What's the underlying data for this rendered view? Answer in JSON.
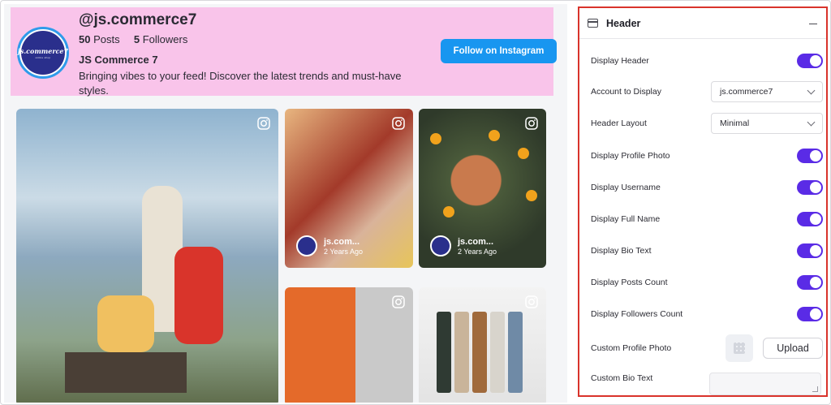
{
  "profile": {
    "username": "@js.commerce7",
    "posts_count": "50",
    "posts_label": "Posts",
    "followers_count": "5",
    "followers_label": "Followers",
    "full_name": "JS Commerce 7",
    "bio": "Bringing vibes to your feed! Discover the latest trends and must-have styles.",
    "avatar_brand": "js.commerce7",
    "avatar_tag": "online shop",
    "follow_label": "Follow on Instagram"
  },
  "feed": {
    "posts": [
      {
        "handle": "js.com...",
        "time": "2 Years Ago"
      },
      {
        "handle": "js.com...",
        "time": "2 Years Ago"
      }
    ]
  },
  "panel": {
    "title": "Header",
    "display_header": "Display Header",
    "account_label": "Account to Display",
    "account_value": "js.commerce7",
    "layout_label": "Header Layout",
    "layout_value": "Minimal",
    "profile_photo": "Display Profile Photo",
    "username": "Display Username",
    "full_name": "Display Full Name",
    "bio_text": "Display Bio Text",
    "posts_count": "Display Posts Count",
    "followers_count": "Display Followers Count",
    "custom_photo": "Custom Profile Photo",
    "upload_label": "Upload",
    "custom_bio": "Custom Bio Text"
  },
  "colors": {
    "banner": "#f9c4ea",
    "follow_button": "#1896f0",
    "toggle_on": "#5a2be6",
    "highlight_border": "#d9332b"
  }
}
